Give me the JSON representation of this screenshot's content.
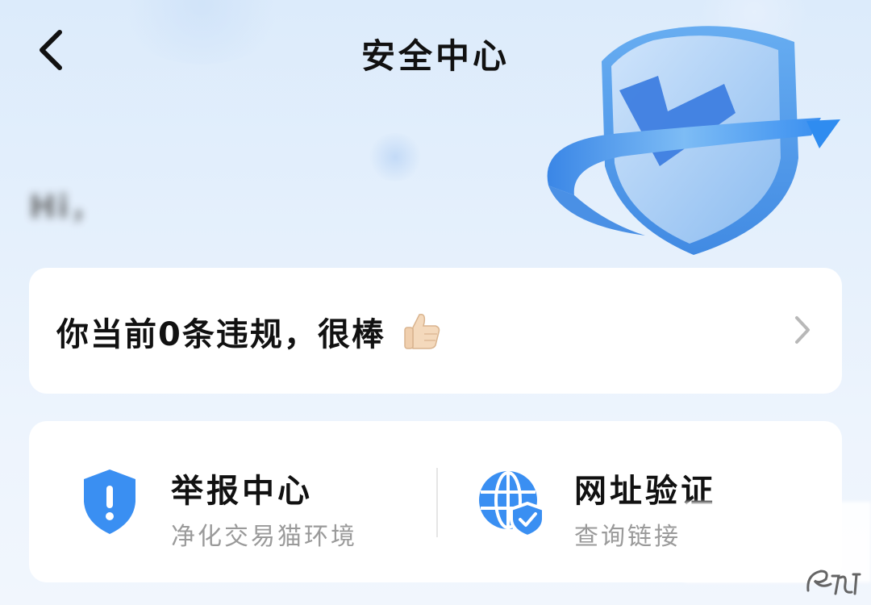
{
  "header": {
    "title": "安全中心",
    "back_icon": "chevron-left-icon"
  },
  "user": {
    "greeting": "Hi，          "
  },
  "hero": {
    "icon": "shield-check-icon",
    "colors": {
      "shield": "#4f9ae8",
      "check": "#3e7ee0",
      "ring": "#3f95ec"
    }
  },
  "violation": {
    "text": "你当前0条违规，很棒",
    "icon": "thumbs-up-icon",
    "action_icon": "chevron-right-icon"
  },
  "tools": [
    {
      "title": "举报中心",
      "subtitle": "净化交易猫环境",
      "icon": "shield-alert-icon"
    },
    {
      "title": "网址验证",
      "subtitle": "查询链接",
      "icon": "globe-shield-icon"
    }
  ],
  "colors": {
    "accent": "#3a8ff2",
    "text_primary": "#111111",
    "text_secondary": "#9a9a9a",
    "card_bg": "#ffffff"
  }
}
